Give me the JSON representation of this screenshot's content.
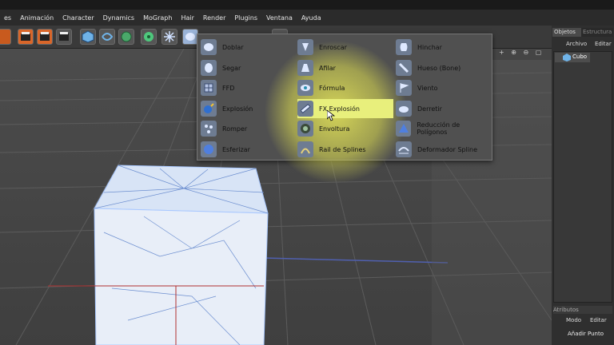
{
  "menubar": [
    "es",
    "Animación",
    "Character",
    "Dynamics",
    "MoGraph",
    "Hair",
    "Render",
    "Plugins",
    "Ventana",
    "Ayuda"
  ],
  "toolbar": {
    "icons": [
      "film-icon",
      "film-icon",
      "film-icon",
      "cube-icon",
      "loop-icon",
      "grid-sphere-icon",
      "gear-flower-icon",
      "deformer-icon"
    ]
  },
  "viewport": {
    "strip": "+ ⊕ ⊖ ▢"
  },
  "deformer_menu": {
    "columns": [
      [
        {
          "label": "Doblar",
          "icon": "bend-icon"
        },
        {
          "label": "Segar",
          "icon": "shear-icon"
        },
        {
          "label": "FFD",
          "icon": "ffd-icon"
        },
        {
          "label": "Explosión",
          "icon": "explosion-icon"
        },
        {
          "label": "Romper",
          "icon": "shatter-icon"
        },
        {
          "label": "Esferizar",
          "icon": "sphere-icon"
        }
      ],
      [
        {
          "label": "Enroscar",
          "icon": "twist-icon"
        },
        {
          "label": "Afilar",
          "icon": "taper-icon"
        },
        {
          "label": "Fórmula",
          "icon": "formula-icon"
        },
        {
          "label": "FX Explosión",
          "icon": "fx-explosion-icon",
          "highlight": true
        },
        {
          "label": "Envoltura",
          "icon": "wrap-icon"
        },
        {
          "label": "Rail de Splines",
          "icon": "spline-rail-icon"
        }
      ],
      [
        {
          "label": "Hinchar",
          "icon": "bulge-icon"
        },
        {
          "label": "Hueso (Bone)",
          "icon": "bone-icon"
        },
        {
          "label": "Viento",
          "icon": "wind-icon"
        },
        {
          "label": "Derretir",
          "icon": "melt-icon"
        },
        {
          "label": "Reducción de Polígonos",
          "icon": "polygon-reduction-icon"
        },
        {
          "label": "Deformador Spline",
          "icon": "spline-deformer-icon"
        }
      ]
    ]
  },
  "objects_panel": {
    "tabs": [
      "Objetos",
      "Estructura"
    ],
    "menu": [
      "Archivo",
      "Editar"
    ],
    "object_name": "Cubo"
  },
  "attributes_panel": {
    "title": "Atributos",
    "menu": [
      "Modo",
      "Editar"
    ],
    "button": "Añadir Punto"
  },
  "colors": {
    "highlight": "#e8ef7c",
    "glow": "#e6e65a",
    "menu_bg": "#505050",
    "mesh": "#a9c8ff"
  }
}
